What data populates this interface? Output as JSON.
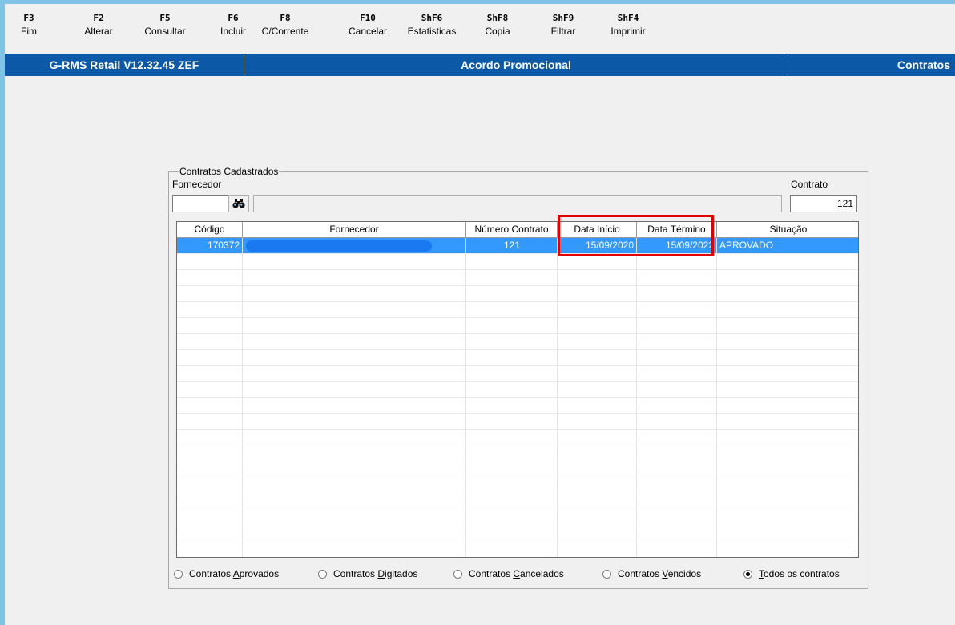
{
  "toolbar": {
    "keys": [
      {
        "key": "F3",
        "label": "Fim"
      },
      {
        "key": "F2",
        "label": "Alterar"
      },
      {
        "key": "F5",
        "label": "Consultar"
      },
      {
        "key": "F6",
        "label": "Incluir"
      },
      {
        "key": "F8",
        "label": "C/Corrente"
      },
      {
        "key": "F10",
        "label": "Cancelar"
      },
      {
        "key": "ShF6",
        "label": "Estatisticas"
      },
      {
        "key": "ShF8",
        "label": "Copia"
      },
      {
        "key": "ShF9",
        "label": "Filtrar"
      },
      {
        "key": "ShF4",
        "label": "Imprimir"
      }
    ]
  },
  "titlebar": {
    "app": "G-RMS Retail V12.32.45 ZEF",
    "screen": "Acordo Promocional",
    "module": "Contratos"
  },
  "group": {
    "legend": "Contratos Cadastrados",
    "fornecedor_label": "Fornecedor",
    "fornecedor_value": "",
    "fornecedor_name": "",
    "contrato_label": "Contrato",
    "contrato_value": "121"
  },
  "grid": {
    "columns": [
      "Código",
      "Fornecedor",
      "Número Contrato",
      "Data Início",
      "Data Término",
      "Situação"
    ],
    "rows": [
      {
        "codigo": "170372",
        "fornecedor": "",
        "numero": "121",
        "inicio": "15/09/2020",
        "termino": "15/09/2022",
        "situacao": "APROVADO"
      }
    ]
  },
  "filters": {
    "options": [
      {
        "pre": "Contratos ",
        "acc": "A",
        "post": "provados",
        "selected": false
      },
      {
        "pre": "Contratos ",
        "acc": "D",
        "post": "igitados",
        "selected": false
      },
      {
        "pre": "Contratos ",
        "acc": "C",
        "post": "ancelados",
        "selected": false
      },
      {
        "pre": "Contratos ",
        "acc": "V",
        "post": "encidos",
        "selected": false
      },
      {
        "pre": "",
        "acc": "T",
        "post": "odos os contratos",
        "selected": true
      }
    ]
  },
  "colors": {
    "titlebar_bg": "#0c59a7",
    "selection": "#3399ff",
    "highlight_box": "#e10000",
    "redaction": "#1a78f0"
  },
  "icons": {
    "find": "binoculars-icon"
  }
}
